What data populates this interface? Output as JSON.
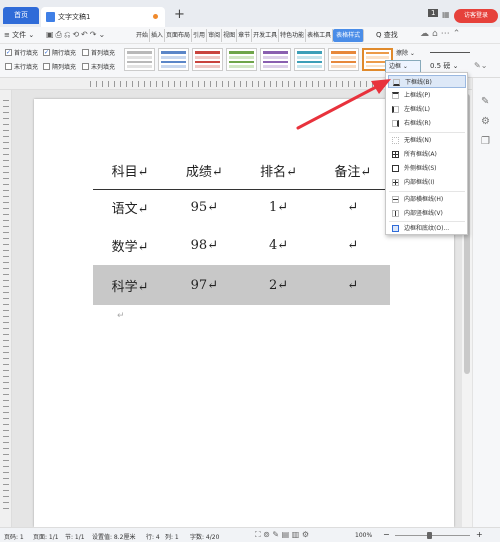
{
  "titlebar": {
    "home_tab": "首页",
    "doc_tab": "文字文稿1",
    "new_tab": "+",
    "badge": "1",
    "login": "访客登录"
  },
  "menubar": {
    "file": "≡ 文件 ⌄",
    "tabs": [
      "开始",
      "插入",
      "页面布局",
      "引用",
      "审阅",
      "视图",
      "章节",
      "开发工具",
      "特色功能",
      "表格工具",
      "表格样式"
    ],
    "active_tab": "表格样式",
    "search": "Q 查找"
  },
  "ribbon": {
    "checks": [
      {
        "label": "首行填充",
        "checked": true
      },
      {
        "label": "隔行填充",
        "checked": true
      },
      {
        "label": "首列填充",
        "checked": false
      },
      {
        "label": "末行填充",
        "checked": false
      },
      {
        "label": "隔列填充",
        "checked": false
      },
      {
        "label": "末列填充",
        "checked": false
      }
    ],
    "draw_label": "擦除 ⌄",
    "border_label": "边框 ⌄",
    "pen_size": "0.5 磅 ⌄",
    "style_colors": [
      "#b9b9b9",
      "#5b86c8",
      "#c9443e",
      "#6fa54a",
      "#8a5fb0",
      "#3c9fb8",
      "#e7883a",
      "#ec9b48"
    ]
  },
  "table": {
    "header": [
      "科目↵",
      "成绩↵",
      "排名↵",
      "备注↵"
    ],
    "rows": [
      [
        "语文↵",
        "95↵",
        "1↵",
        "↵"
      ],
      [
        "数学↵",
        "98↵",
        "4↵",
        "↵"
      ],
      [
        "科学↵",
        "97↵",
        "2↵",
        "↵"
      ]
    ]
  },
  "cursor_mark": "↵",
  "dropdown": {
    "items": [
      "下框线(B)",
      "上框线(P)",
      "左框线(L)",
      "右框线(R)",
      "无框线(N)",
      "所有框线(A)",
      "外侧框线(S)",
      "内部框线(I)",
      "内部横框线(H)",
      "内部竖框线(V)",
      "边框和底纹(O)..."
    ],
    "highlighted_index": 0
  },
  "statusbar": {
    "page": "页码: 1",
    "pages": "页面: 1/1",
    "section": "节: 1/1",
    "position": "设置值: 8.2厘米",
    "row": "行: 4",
    "col": "列: 1",
    "words": "字数: 4/20",
    "zoom": "100%"
  },
  "colors": {
    "accent": "#2f6bd8",
    "selected_row": "#c8c8c8",
    "arrow": "#e8323c"
  }
}
